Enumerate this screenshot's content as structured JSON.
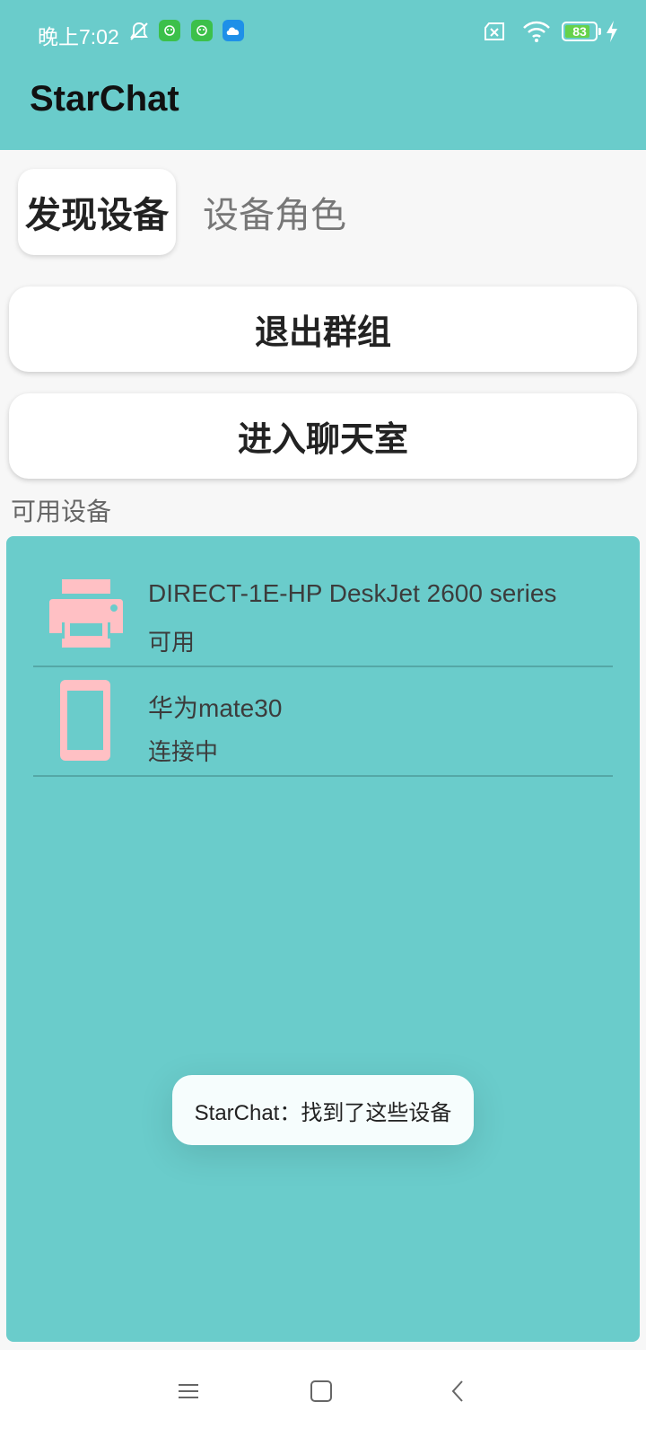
{
  "status_bar": {
    "time": "晚上7:02",
    "battery_level": "83",
    "battery_percent": 83,
    "icons": [
      "notifications-off-icon",
      "app-badge-icon",
      "app-badge-icon",
      "cloud-icon",
      "sim-off-icon",
      "wifi-icon",
      "battery-icon",
      "charging-icon"
    ]
  },
  "app_bar": {
    "title": "StarChat"
  },
  "tabs": [
    {
      "label": "发现设备",
      "selected": true
    },
    {
      "label": "设备角色",
      "selected": false
    }
  ],
  "actions": {
    "leave_group": "退出群组",
    "enter_chatroom": "进入聊天室"
  },
  "devices": {
    "section_title": "可用设备",
    "items": [
      {
        "name": "DIRECT-1E-HP DeskJet 2600 series",
        "status": "可用",
        "icon": "printer-icon"
      },
      {
        "name": "华为mate30",
        "status": "连接中",
        "icon": "phone-icon"
      }
    ]
  },
  "toast": {
    "message": "StarChat：找到了这些设备"
  },
  "nav": {
    "icons": [
      "menu-icon",
      "home-icon",
      "back-icon"
    ]
  },
  "colors": {
    "accent": "#6acccb",
    "device_icon": "#ffc0c4",
    "background": "#f7f7f7"
  }
}
